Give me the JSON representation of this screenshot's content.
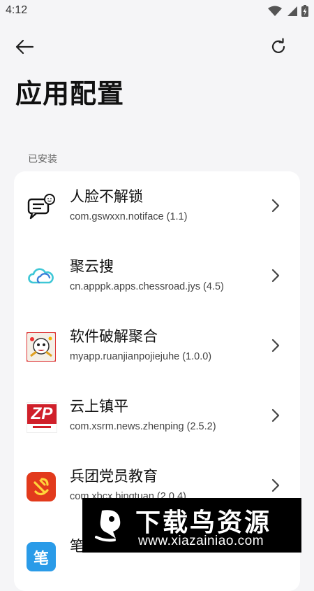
{
  "status_bar": {
    "time": "4:12"
  },
  "header": {
    "title": "应用配置"
  },
  "section": {
    "label": "已安装"
  },
  "apps": [
    {
      "name": "人脸不解锁",
      "package": "com.gswxxn.notiface (1.1)",
      "icon": "face-chat-icon"
    },
    {
      "name": "聚云搜",
      "package": "cn.apppk.apps.chessroad.jys (4.5)",
      "icon": "cloud-icon"
    },
    {
      "name": "软件破解聚合",
      "package": "myapp.ruanjianpojiejuhe (1.0.0)",
      "icon": "cartoon-app-icon"
    },
    {
      "name": "云上镇平",
      "package": "com.xsrm.news.zhenping (2.5.2)",
      "icon": "zp-logo-icon",
      "icon_text": "ZP"
    },
    {
      "name": "兵团党员教育",
      "package": "com.xbcx.bingtuan (2.0.4)",
      "icon": "party-emblem-icon"
    },
    {
      "name": "笔",
      "package": "",
      "icon": "app-icon-blue",
      "icon_text": "笔"
    }
  ],
  "watermark": {
    "title": "下载鸟资源",
    "url": "www.xiazainiao.com"
  },
  "colors": {
    "background": "#f5f5f7",
    "card": "#ffffff",
    "zp_red": "#d0202a",
    "party_red": "#e23a1c",
    "cloud_teal": "#3ec7d6",
    "cloud_blue": "#3b7fd9"
  }
}
